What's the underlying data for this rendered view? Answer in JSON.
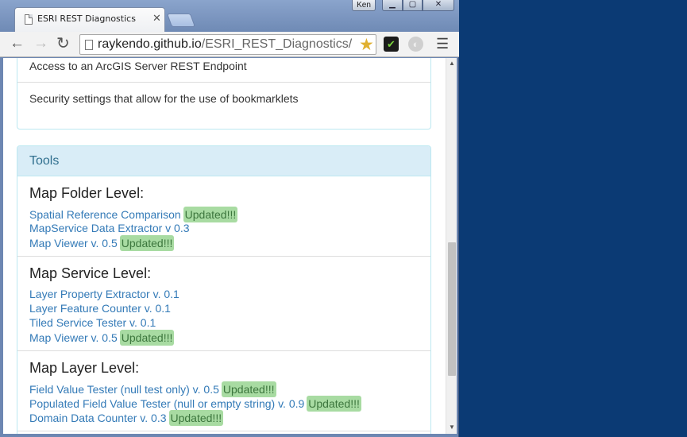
{
  "browser": {
    "tab_title": "ESRI REST Diagnostics",
    "tab_close": "✕",
    "user_name": "Ken",
    "url_host": "raykendo.github.io",
    "url_path": "/ESRI_REST_Diagnostics/",
    "icons": {
      "back": "back-arrow-icon",
      "forward": "forward-arrow-icon",
      "reload": "reload-icon",
      "bookmark": "star-icon",
      "menu": "hamburger-menu-icon"
    }
  },
  "requirements": {
    "items": [
      "Access to an ArcGIS Server REST Endpoint",
      "Security settings that allow for the use of bookmarklets"
    ]
  },
  "tools": {
    "heading": "Tools",
    "badge_text": "Updated!!!",
    "sections": [
      {
        "title": "Map Folder Level:",
        "links": [
          {
            "label": "Spatial Reference Comparison",
            "badge": "Updated!!!"
          },
          {
            "label": "MapService Data Extractor v 0.3"
          },
          {
            "label": "Map Viewer v. 0.5",
            "badge": "Updated!!!"
          }
        ]
      },
      {
        "title": "Map Service Level:",
        "links": [
          {
            "label": "Layer Property Extractor v. 0.1"
          },
          {
            "label": "Layer Feature Counter v. 0.1"
          },
          {
            "label": "Tiled Service Tester v. 0.1"
          },
          {
            "label": "Map Viewer v. 0.5",
            "badge": "Updated!!!"
          }
        ]
      },
      {
        "title": "Map Layer Level:",
        "links": [
          {
            "label": "Field Value Tester (null test only) v. 0.5",
            "badge": "Updated!!!"
          },
          {
            "label": "Populated Field Value Tester (null or empty string) v. 0.9",
            "badge": "Updated!!!"
          },
          {
            "label": "Domain Data Counter v. 0.3",
            "badge": "Updated!!!"
          }
        ]
      }
    ]
  }
}
